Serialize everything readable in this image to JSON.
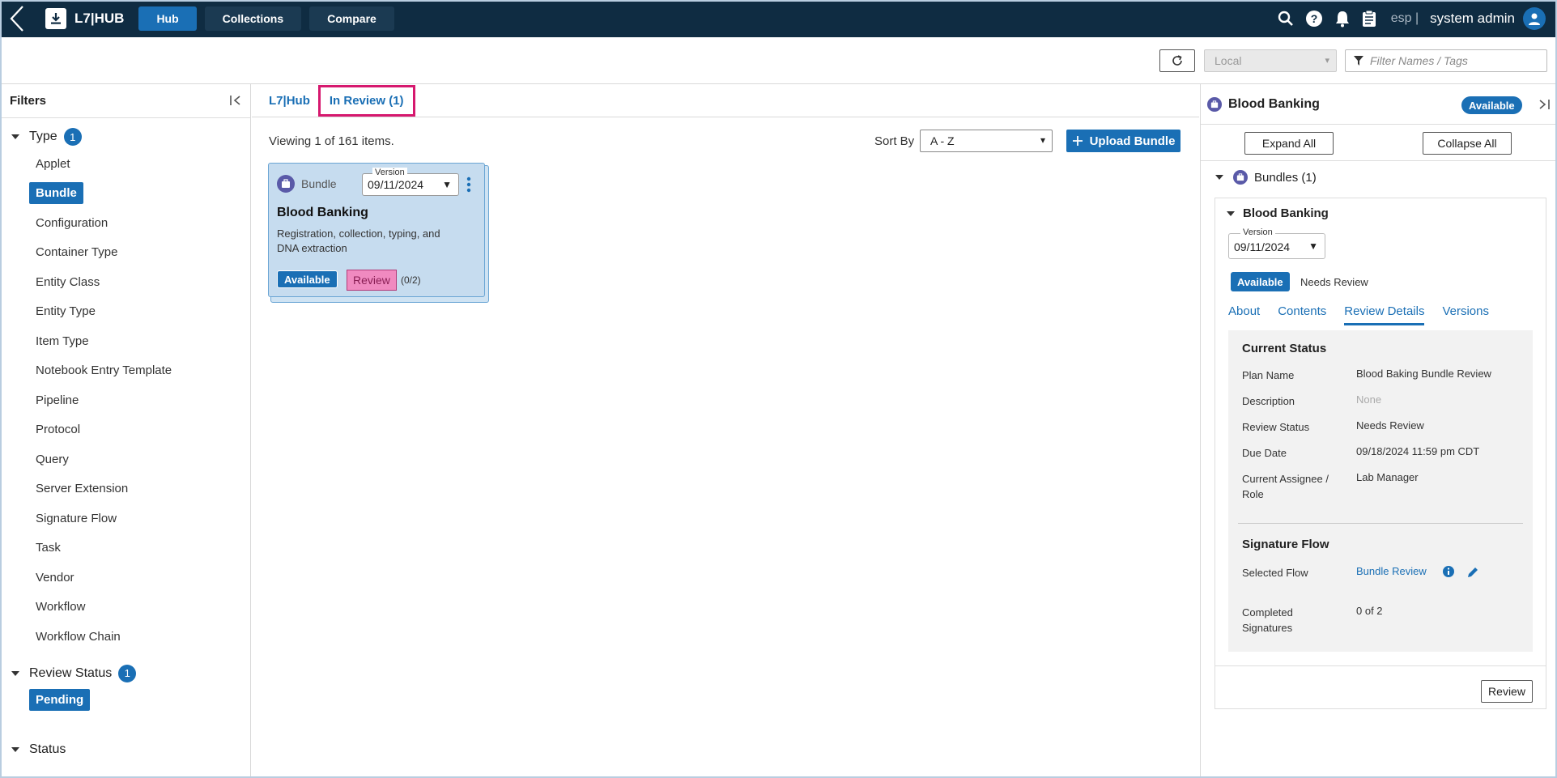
{
  "nav": {
    "logo": "L7|HUB",
    "buttons": [
      "Hub",
      "Collections",
      "Compare"
    ],
    "esp": "esp |",
    "user": "system admin"
  },
  "toolbar": {
    "local": "Local",
    "filter_placeholder": "Filter Names / Tags"
  },
  "sidebar": {
    "title": "Filters",
    "type_group": {
      "label": "Type",
      "count": "1",
      "items": [
        "Applet",
        "Bundle",
        "Configuration",
        "Container Type",
        "Entity Class",
        "Entity Type",
        "Item Type",
        "Notebook Entry Template",
        "Pipeline",
        "Protocol",
        "Query",
        "Server Extension",
        "Signature Flow",
        "Task",
        "Vendor",
        "Workflow",
        "Workflow Chain"
      ],
      "selected": "Bundle"
    },
    "review_group": {
      "label": "Review Status",
      "count": "1",
      "items": [
        "Pending"
      ]
    },
    "status_group": {
      "label": "Status"
    }
  },
  "main": {
    "crumb_root": "L7|Hub",
    "crumb_active": "In Review (1)",
    "viewing": "Viewing 1 of 161 items.",
    "sort_label": "Sort By",
    "sort_value": "A - Z",
    "upload": "Upload Bundle",
    "card": {
      "type": "Bundle",
      "version_label": "Version",
      "version": "09/11/2024",
      "title": "Blood Banking",
      "desc": "Registration, collection, typing, and DNA extraction",
      "available": "Available",
      "review": "Review",
      "count": "(0/2)"
    }
  },
  "panel": {
    "title": "Blood Banking",
    "status": "Available",
    "expand": "Expand All",
    "collapse": "Collapse All",
    "bundles": "Bundles (1)",
    "item_title": "Blood Banking",
    "version_label": "Version",
    "version": "09/11/2024",
    "badge": "Available",
    "needs": "Needs Review",
    "tabs": [
      "About",
      "Contents",
      "Review Details",
      "Versions"
    ],
    "current_status": "Current Status",
    "rows": [
      {
        "k": "Plan Name",
        "v": "Blood Baking Bundle Review"
      },
      {
        "k": "Description",
        "v": "None"
      },
      {
        "k": "Review Status",
        "v": "Needs Review"
      },
      {
        "k": "Due Date",
        "v": "09/18/2024 11:59 pm CDT"
      },
      {
        "k": "Current Assignee / Role",
        "v": "Lab Manager"
      }
    ],
    "signature_flow": "Signature Flow",
    "selected_flow_k": "Selected Flow",
    "selected_flow_v": "Bundle Review",
    "completed_k": "Completed Signatures",
    "completed_v": "0 of 2",
    "review_btn": "Review"
  },
  "colors": {
    "nav_bg": "#0f2c42",
    "accent": "#1a6fb5",
    "highlight": "#d6186e",
    "review_pink": "#f08ac0"
  }
}
